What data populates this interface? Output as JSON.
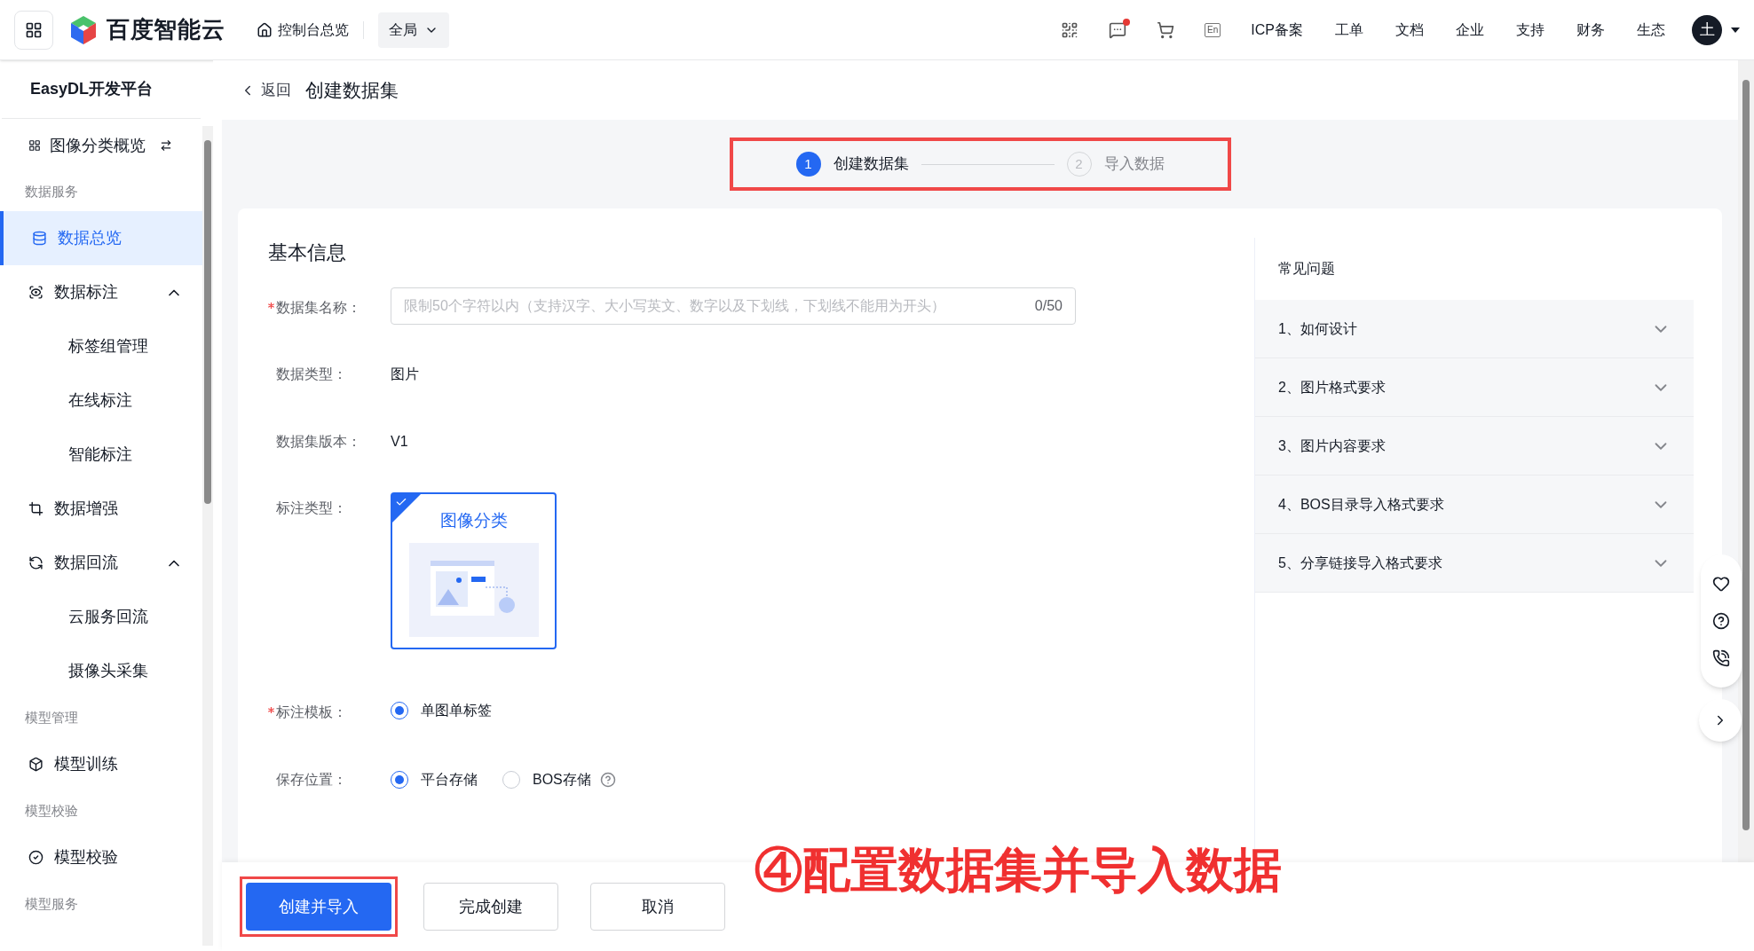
{
  "top_bar": {
    "brand": "百度智能云",
    "home_link": "控制台总览",
    "region_select": "全局",
    "unread": true,
    "lang_badge": "En",
    "nav_links": [
      "ICP备案",
      "工单",
      "文档",
      "企业",
      "支持",
      "财务",
      "生态"
    ],
    "avatar": "土"
  },
  "sidebar": {
    "title": "EasyDL开发平台",
    "overview": "图像分类概览",
    "groups": [
      {
        "heading": "数据服务",
        "items": [
          {
            "label": "数据总览",
            "selected": true
          },
          {
            "label": "数据标注",
            "selected": false,
            "expanded": true,
            "children": [
              {
                "label": "标签组管理",
                "selected": false
              },
              {
                "label": "在线标注",
                "selected": false
              },
              {
                "label": "智能标注",
                "selected": false
              }
            ]
          },
          {
            "label": "数据增强",
            "selected": false
          },
          {
            "label": "数据回流",
            "selected": false,
            "expanded": true,
            "children": [
              {
                "label": "云服务回流",
                "selected": false
              },
              {
                "label": "摄像头采集",
                "selected": false
              }
            ]
          }
        ]
      },
      {
        "heading": "模型管理",
        "items": [
          {
            "label": "模型训练",
            "selected": false
          }
        ]
      },
      {
        "heading": "模型校验",
        "items": [
          {
            "label": "模型校验",
            "selected": false
          }
        ]
      },
      {
        "heading": "模型服务"
      }
    ]
  },
  "page": {
    "back": "返回",
    "title": "创建数据集"
  },
  "steps": {
    "highlighted": true,
    "items": [
      {
        "number": "1",
        "label": "创建数据集",
        "selected": true
      },
      {
        "number": "2",
        "label": "导入数据",
        "selected": false
      }
    ]
  },
  "form": {
    "section_title": "基本信息",
    "fields": [
      {
        "kind": "input",
        "label": "数据集名称：",
        "required": true,
        "placeholder": "限制50个字符以内（支持汉字、大小写英文、数字以及下划线，下划线不能用为开头）",
        "counter": "0/50"
      },
      {
        "kind": "text",
        "label": "数据类型：",
        "required": false,
        "value": "图片"
      },
      {
        "kind": "text",
        "label": "数据集版本：",
        "required": false,
        "value": "V1"
      },
      {
        "kind": "cards",
        "label": "标注类型：",
        "required": false,
        "options": [
          {
            "label": "图像分类",
            "selected": true
          }
        ]
      },
      {
        "kind": "radio",
        "label": "标注模板：",
        "required": true,
        "options": [
          {
            "label": "单图单标签",
            "selected": true,
            "help": false
          }
        ]
      },
      {
        "kind": "radio",
        "label": "保存位置：",
        "required": false,
        "options": [
          {
            "label": "平台存储",
            "selected": true,
            "help": false
          },
          {
            "label": "BOS存储",
            "selected": false,
            "help": true
          }
        ]
      }
    ]
  },
  "faq": {
    "title": "常见问题",
    "items": [
      {
        "label": "1、如何设计",
        "expanded": false
      },
      {
        "label": "2、图片格式要求",
        "expanded": false
      },
      {
        "label": "3、图片内容要求",
        "expanded": false
      },
      {
        "label": "4、BOS目录导入格式要求",
        "expanded": false
      },
      {
        "label": "5、分享链接导入格式要求",
        "expanded": false
      }
    ]
  },
  "footer_buttons": [
    {
      "label": "创建并导入",
      "kind": "primary",
      "highlighted": true
    },
    {
      "label": "完成创建",
      "kind": "default",
      "highlighted": false
    },
    {
      "label": "取消",
      "kind": "default",
      "highlighted": false
    }
  ],
  "annotation": {
    "text": "④配置数据集并导入数据"
  }
}
